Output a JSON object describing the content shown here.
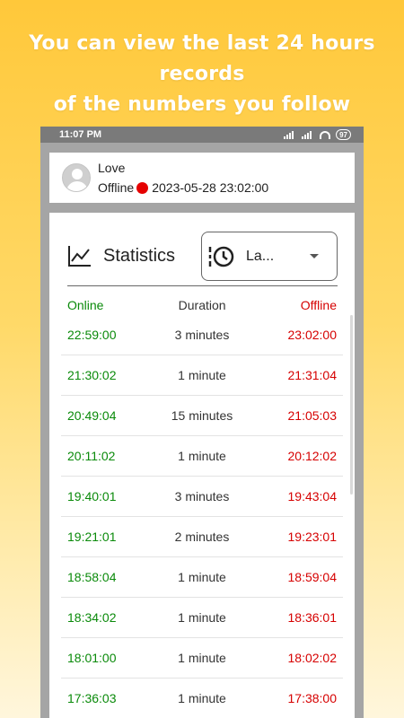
{
  "headline": {
    "line1": "You can view the last 24 hours records",
    "line2": "of the numbers you follow"
  },
  "statusbar": {
    "time": "11:07 PM",
    "battery": "97"
  },
  "contact": {
    "name": "Love",
    "status": "Offline",
    "timestamp": "2023-05-28 23:02:00",
    "status_color": "#e50000"
  },
  "stats": {
    "title": "Statistics",
    "filter_value": "La...",
    "columns": {
      "online": "Online",
      "duration": "Duration",
      "offline": "Offline"
    },
    "rows": [
      {
        "online": "22:59:00",
        "duration": "3 minutes",
        "offline": "23:02:00"
      },
      {
        "online": "21:30:02",
        "duration": "1 minute",
        "offline": "21:31:04"
      },
      {
        "online": "20:49:04",
        "duration": "15 minutes",
        "offline": "21:05:03"
      },
      {
        "online": "20:11:02",
        "duration": "1 minute",
        "offline": "20:12:02"
      },
      {
        "online": "19:40:01",
        "duration": "3 minutes",
        "offline": "19:43:04"
      },
      {
        "online": "19:21:01",
        "duration": "2 minutes",
        "offline": "19:23:01"
      },
      {
        "online": "18:58:04",
        "duration": "1 minute",
        "offline": "18:59:04"
      },
      {
        "online": "18:34:02",
        "duration": "1 minute",
        "offline": "18:36:01"
      },
      {
        "online": "18:01:00",
        "duration": "1 minute",
        "offline": "18:02:02"
      },
      {
        "online": "17:36:03",
        "duration": "1 minute",
        "offline": "17:38:00"
      }
    ]
  },
  "colors": {
    "online": "#0a8a0a",
    "offline": "#d60000",
    "background_top": "#ffc83a"
  }
}
